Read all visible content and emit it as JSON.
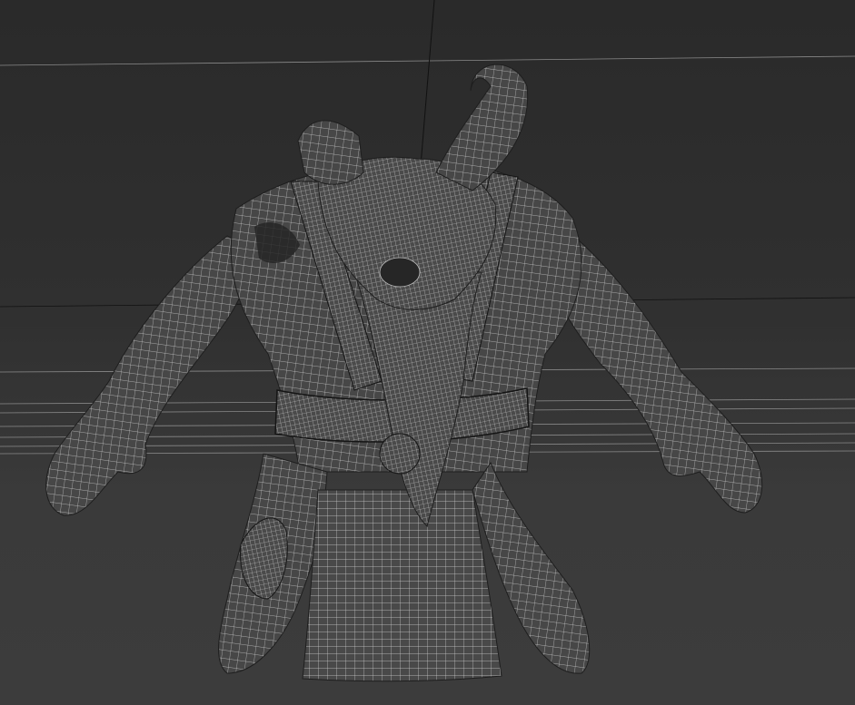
{
  "viewport": {
    "background_top": "#2a2a2a",
    "background_bottom": "#3c3c3c",
    "wire_color": "#c9c9c9",
    "shade_color": "#232323",
    "grid_color": "#8a8a8a"
  },
  "scene": {
    "object": "creature-mesh",
    "display_mode": "wireframe-on-shaded"
  }
}
